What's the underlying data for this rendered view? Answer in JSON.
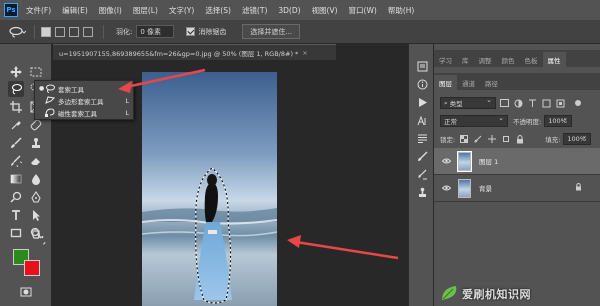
{
  "app": {
    "logo": "Ps"
  },
  "menu": [
    "文件(F)",
    "编辑(E)",
    "图像(I)",
    "图层(L)",
    "文字(Y)",
    "选择(S)",
    "滤镜(T)",
    "3D(D)",
    "视图(V)",
    "窗口(W)",
    "帮助(H)"
  ],
  "options": {
    "feather_label": "羽化:",
    "feather_value": "0 像素",
    "antialias_label": "消除锯齿",
    "antialias_checked": true,
    "select_mask_button": "选择并遮住..."
  },
  "document": {
    "tab_title": "u=1951907155,869389655&fm=26&gp=0.jpg @ 50% (图层 1, RGB/8#) *",
    "close_symbol": "×"
  },
  "flyout": {
    "items": [
      {
        "label": "套索工具",
        "shortcut": "",
        "selected": true,
        "icon": "lasso-icon"
      },
      {
        "label": "多边形套索工具",
        "shortcut": "L",
        "selected": false,
        "icon": "polygonal-lasso-icon"
      },
      {
        "label": "磁性套索工具",
        "shortcut": "L",
        "selected": false,
        "icon": "magnetic-lasso-icon"
      }
    ]
  },
  "panels": {
    "top_tabs": [
      "学习",
      "库",
      "调整",
      "颜色",
      "色板",
      "属性"
    ],
    "top_active": "属性",
    "layer_tabs": [
      "图层",
      "通道",
      "路径"
    ],
    "layer_active": "图层",
    "filter_label": "类型",
    "blend_mode": "正常",
    "opacity_label": "不透明度:",
    "opacity_value": "100%",
    "lock_label": "锁定:",
    "fill_label": "填充:",
    "fill_value": "100%"
  },
  "layers": [
    {
      "name": "图层 1",
      "selected": true,
      "locked": false
    },
    {
      "name": "背景",
      "selected": false,
      "locked": true
    }
  ],
  "colors": {
    "foreground": "#2a8a1a",
    "background": "#e8101a",
    "annotation_arrow": "#e8474a"
  },
  "watermark": "爱刷机知识网"
}
